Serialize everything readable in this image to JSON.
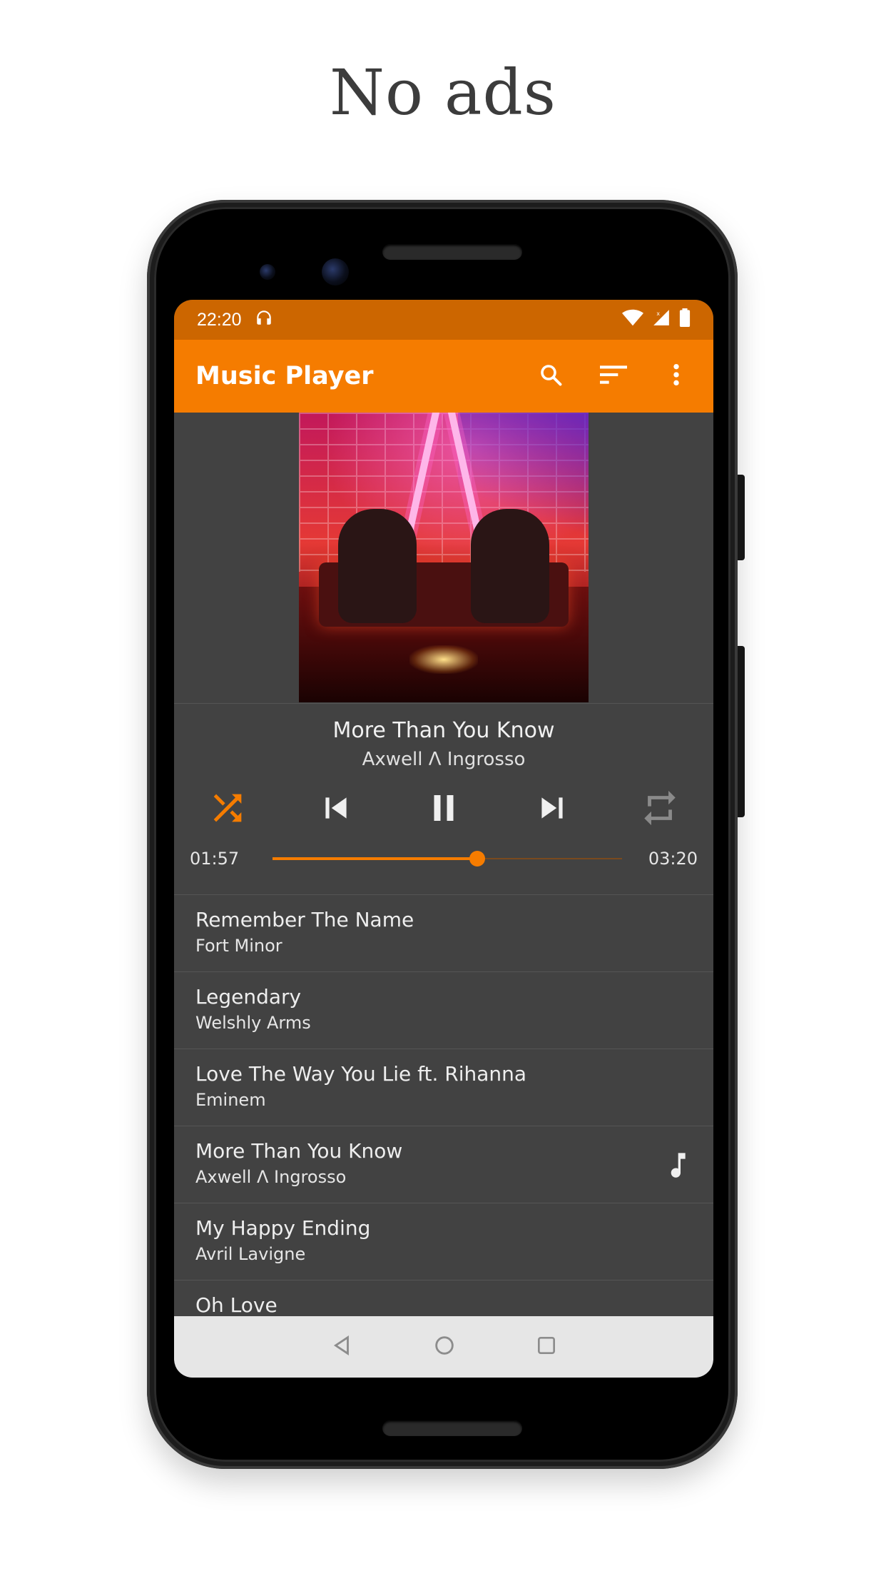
{
  "headline": "No ads",
  "status_bar": {
    "time": "22:20"
  },
  "app_bar": {
    "title": "Music Player",
    "actions": [
      "search-icon",
      "sort-icon",
      "more-vert-icon"
    ]
  },
  "now_playing": {
    "title": "More Than You Know",
    "artist": "Axwell Λ Ingrosso",
    "elapsed": "01:57",
    "duration": "03:20",
    "progress": 0.585,
    "shuffle_on": true,
    "repeat_on": false
  },
  "playlist": [
    {
      "title": "Remember The Name",
      "artist": "Fort Minor",
      "playing": false
    },
    {
      "title": "Legendary",
      "artist": "Welshly Arms",
      "playing": false
    },
    {
      "title": "Love The Way You Lie ft. Rihanna",
      "artist": "Eminem",
      "playing": false
    },
    {
      "title": "More Than You Know",
      "artist": "Axwell Λ Ingrosso",
      "playing": true
    },
    {
      "title": "My Happy Ending",
      "artist": "Avril Lavigne",
      "playing": false
    },
    {
      "title": "Oh Love",
      "artist": "",
      "playing": false
    }
  ],
  "colors": {
    "accent": "#f57c00",
    "status_bar": "#cc6600",
    "background": "#424242",
    "nav_bar": "#e6e6e6"
  }
}
